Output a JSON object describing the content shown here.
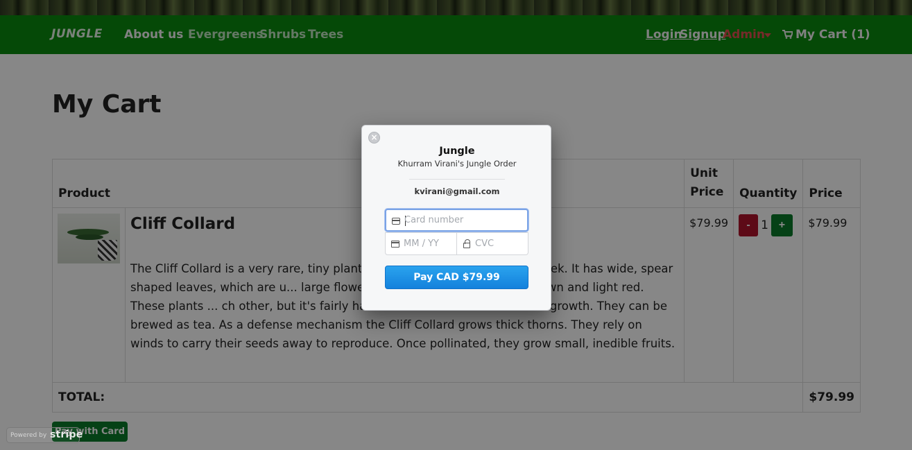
{
  "header": {
    "brand": "JUNGLE",
    "about": "About us",
    "categories": [
      "Evergreens",
      "Shrubs",
      "Trees"
    ],
    "login": "Login",
    "signup": "Signup",
    "admin": "Admin",
    "cart": "My Cart (1)"
  },
  "page": {
    "title": "My Cart"
  },
  "table": {
    "headers": {
      "product": "Product",
      "unit_price_line1": "Unit",
      "unit_price_line2": "Price",
      "quantity": "Quantity",
      "price": "Price"
    },
    "item": {
      "name": "Cliff Collard",
      "description": "The Cliff Collard is a very rare, tiny plant and ... ms twice a year, for 1 week. It has wide, spear shaped leaves, which are u... large flowers, which can be silver, light brown and light red. These plants ... ch other, but it's fairly hard to control and maintain their growth. They can be brewed as tea. As a defense mechanism the Cliff Collard grows thick thorns. They rely on winds to carry their seeds away to reproduce. Once pollinated, they grow small, inedible fruits.",
      "unit_price": "$79.99",
      "quantity": "1",
      "minus": "-",
      "plus": "+",
      "price": "$79.99"
    },
    "total_label": "TOTAL:",
    "total_value": "$79.99"
  },
  "pay_with_card": "Pay with Card",
  "powered_by": {
    "prefix": "Powered by",
    "brand": "stripe"
  },
  "modal": {
    "close": "×",
    "title": "Jungle",
    "subtitle": "Khurram Virani's Jungle Order",
    "email": "kvirani@gmail.com",
    "card_placeholder": "Card number",
    "expiry_placeholder": "MM / YY",
    "cvc_placeholder": "CVC",
    "pay_button": "Pay CAD $79.99"
  },
  "colors": {
    "navbar": "#0a8a0e",
    "admin": "#e05050",
    "minus_button": "#b0132c",
    "plus_button": "#0a7c2b",
    "pay_button": "#1a8fe4"
  }
}
